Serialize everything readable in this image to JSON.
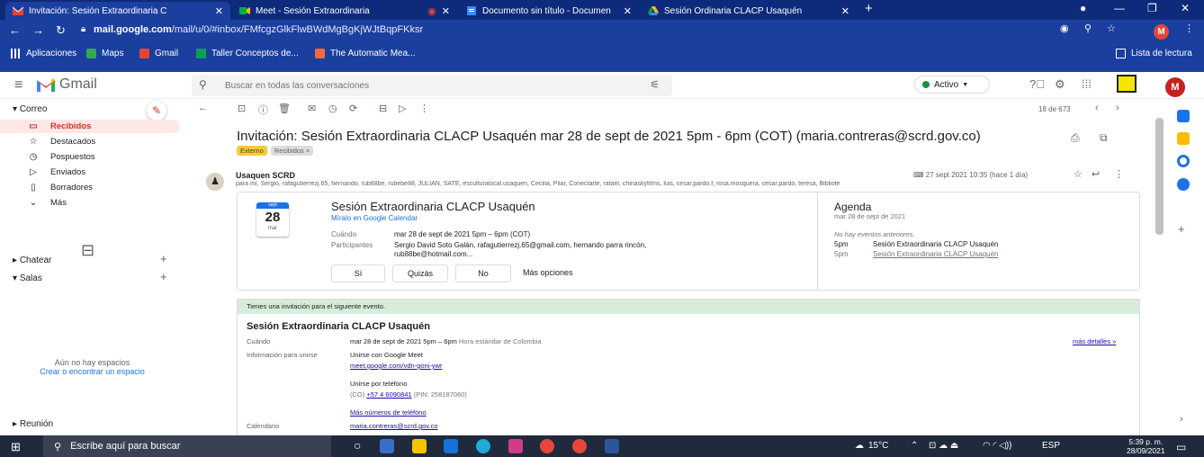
{
  "tabs": [
    {
      "title": "Invitación: Sesión Extraordinaria C",
      "active": true
    },
    {
      "title": "Meet - Sesión Extraordinaria",
      "active": false
    },
    {
      "title": "Documento sin título - Documen",
      "active": false
    },
    {
      "title": "Sesión Ordinaria CLACP Usaquén",
      "active": false
    }
  ],
  "address": {
    "host": "mail.google.com",
    "path": "/mail/u/0/#inbox/FMfcgzGlkFlwBWdMgBgKjWJtBqpFKksr",
    "profile_initial": "M"
  },
  "bookmarks": {
    "items": [
      "Aplicaciones",
      "Maps",
      "Gmail",
      "Taller Conceptos de...",
      "The Automatic Mea..."
    ],
    "reading_list": "Lista de lectura"
  },
  "gmail": {
    "app_name": "Gmail",
    "search_placeholder": "Buscar en todas las conversaciones",
    "status": "Activo",
    "user_initial": "M"
  },
  "sidebar": {
    "mail_section": "Correo",
    "items": [
      {
        "label": "Recibidos",
        "active": true
      },
      {
        "label": "Destacados"
      },
      {
        "label": "Pospuestos"
      },
      {
        "label": "Enviados"
      },
      {
        "label": "Borradores"
      },
      {
        "label": "Más"
      }
    ],
    "chat_section": "Chatear",
    "rooms_section": "Salas",
    "spaces_empty": "Aún no hay espacios",
    "spaces_link": "Crear o encontrar un espacio",
    "meeting_section": "Reunión"
  },
  "toolbar": {
    "count": "18 de 673"
  },
  "message": {
    "subject": "Invitación: Sesión Extraordinaria CLACP Usaquén mar 28 de sept de 2021 5pm - 6pm (COT) (maria.contreras@scrd.gov.co)",
    "labels": [
      "Externo",
      "Recibidos ×"
    ],
    "sender": "Usaquen SCRD",
    "recipients": "para mí, Sergio, rafagutierrezj.65, hernando, rub88be, rubebe88, JULIAN, SATE, esculturalocal.usaquen, Cecilia, Pilar, Conectarte, rafael, chinaskyfilms, luis, cesar.pardo.f, rosa.mosquera, cesar.pardo, teresa, Bibliote",
    "date": "27 sept 2021 10:35 (hace 1 día)"
  },
  "invite": {
    "cal_month_top": "sept",
    "cal_day": "28",
    "cal_weekday": "mar",
    "title": "Sesión Extraordinaria CLACP Usaquén",
    "cal_link": "Míralo en Google Calendar",
    "when_label": "Cuándo",
    "when_value": "mar 28 de sept de 2021 5pm – 6pm (COT)",
    "participants_label": "Participantes",
    "participants_value": "Sergio David Soto Galán, rafagutierrezj.65@gmail.com, hernando parra rincón,",
    "participants_value2": "rub88be@hotmail.com...",
    "rsvp_yes": "Sí",
    "rsvp_maybe": "Quizás",
    "rsvp_no": "No",
    "rsvp_more": "Más opciones",
    "agenda_title": "Agenda",
    "agenda_date": "mar 28 de sept de 2021",
    "agenda_none": "No hay eventos anteriores.",
    "agenda_items": [
      {
        "time": "5pm",
        "title": "Sesión Extraordinaria CLACP Usaquén"
      },
      {
        "time": "5pm",
        "title": "Sesión Extraordinaria CLACP Usaquén"
      }
    ]
  },
  "body": {
    "banner": "Tienes una invitación para el siguiente evento.",
    "title": "Sesión Extraordinaria CLACP Usaquén",
    "when_label": "Cuándo",
    "when_value": "mar 28 de sept de 2021 5pm – 6pm",
    "when_tz": "Hora estándar de Colombia",
    "more_details": "más detalles »",
    "join_label": "Información para unirse",
    "join_meet": "Unirse con Google Meet",
    "meet_link": "meet.google.com/vdn-goni-ywr",
    "join_phone": "Unirse por teléfono",
    "phone_prefix": "(CO)",
    "phone_number": "+57 4 6090841",
    "phone_pin": "(PIN: 258187060)",
    "more_numbers": "Más números de teléfono",
    "calendar_label": "Calendario",
    "calendar_value": "maria.contreras@scrd.gov.co"
  },
  "taskbar": {
    "search_placeholder": "Escribe aquí para buscar",
    "weather": "15°C",
    "lang": "ESP",
    "time": "5:39 p. m.",
    "date": "28/09/2021"
  }
}
